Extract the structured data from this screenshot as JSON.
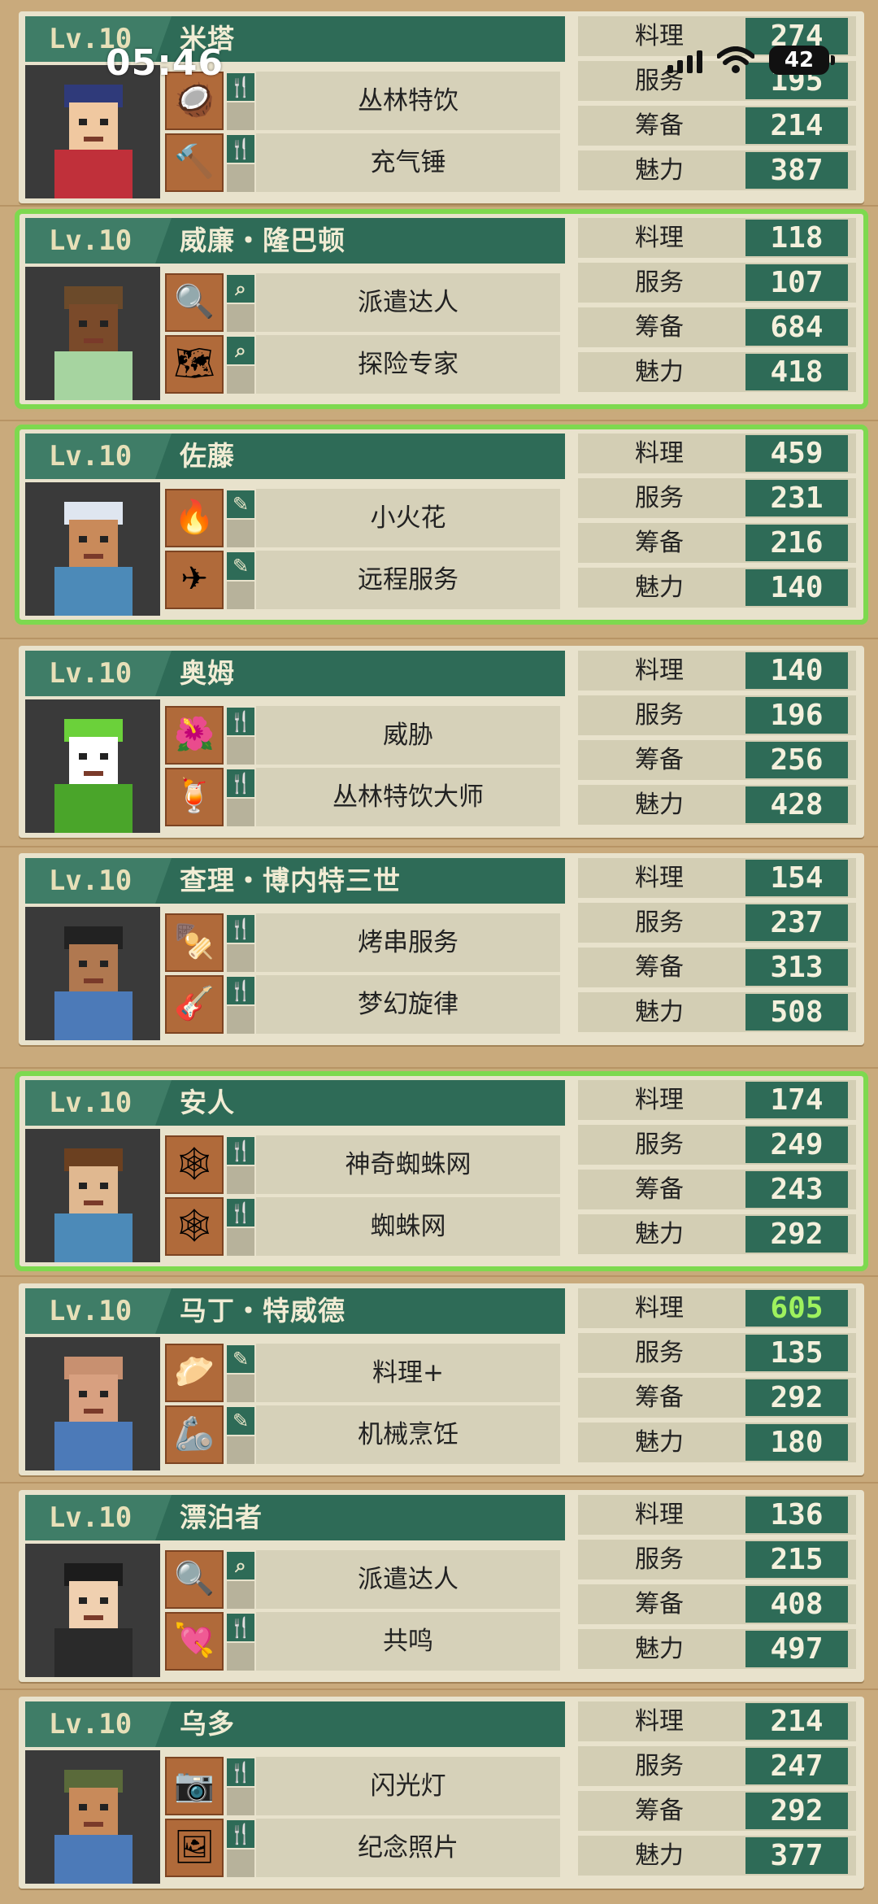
{
  "status_bar": {
    "time": "05:46",
    "battery": "42"
  },
  "stat_labels": [
    "料理",
    "服务",
    "筹备",
    "魅力"
  ],
  "characters": [
    {
      "level": "Lv.10",
      "name": "米塔",
      "selected": false,
      "skills": [
        {
          "label": "丛林特饮",
          "type": "fork-knife-icon",
          "icon": "coconut-drink-icon"
        },
        {
          "label": "充气锤",
          "type": "fork-knife-icon",
          "icon": "inflatable-hammer-icon"
        }
      ],
      "stats": [
        "274",
        "195",
        "214",
        "387"
      ]
    },
    {
      "level": "Lv.10",
      "name": "威廉・隆巴顿",
      "selected": true,
      "skills": [
        {
          "label": "派遣达人",
          "type": "magnifier-icon",
          "icon": "magnifier-icon"
        },
        {
          "label": "探险专家",
          "type": "magnifier-icon",
          "icon": "map-icon"
        }
      ],
      "stats": [
        "118",
        "107",
        "684",
        "418"
      ]
    },
    {
      "level": "Lv.10",
      "name": "佐藤",
      "selected": true,
      "skills": [
        {
          "label": "小火花",
          "type": "brush-icon",
          "icon": "flame-icon"
        },
        {
          "label": "远程服务",
          "type": "brush-icon",
          "icon": "paper-plane-icon"
        }
      ],
      "stats": [
        "459",
        "231",
        "216",
        "140"
      ]
    },
    {
      "level": "Lv.10",
      "name": "奥姆",
      "selected": false,
      "skills": [
        {
          "label": "威胁",
          "type": "fork-knife-icon",
          "icon": "monster-plant-icon"
        },
        {
          "label": "丛林特饮大师",
          "type": "fork-knife-icon",
          "icon": "coconut-drinks-icon"
        }
      ],
      "stats": [
        "140",
        "196",
        "256",
        "428"
      ]
    },
    {
      "level": "Lv.10",
      "name": "查理・博内特三世",
      "selected": false,
      "skills": [
        {
          "label": "烤串服务",
          "type": "fork-knife-icon",
          "icon": "skewer-icon"
        },
        {
          "label": "梦幻旋律",
          "type": "fork-knife-icon",
          "icon": "guitar-icon"
        }
      ],
      "stats": [
        "154",
        "237",
        "313",
        "508"
      ]
    },
    {
      "level": "Lv.10",
      "name": "安人",
      "selected": true,
      "skills": [
        {
          "label": "神奇蜘蛛网",
          "type": "fork-knife-icon",
          "icon": "magic-spider-web-icon"
        },
        {
          "label": "蜘蛛网",
          "type": "fork-knife-icon",
          "icon": "spider-web-icon"
        }
      ],
      "stats": [
        "174",
        "249",
        "243",
        "292"
      ]
    },
    {
      "level": "Lv.10",
      "name": "马丁・特威德",
      "selected": false,
      "skills": [
        {
          "label": "料理+",
          "type": "brush-icon",
          "icon": "dumpling-icon"
        },
        {
          "label": "机械烹饪",
          "type": "brush-icon",
          "icon": "robot-arm-icon"
        }
      ],
      "stats": [
        "605",
        "135",
        "292",
        "180"
      ],
      "highlight_stat": 0
    },
    {
      "level": "Lv.10",
      "name": "漂泊者",
      "selected": false,
      "skills": [
        {
          "label": "派遣达人",
          "type": "magnifier-icon",
          "icon": "magnifier-icon"
        },
        {
          "label": "共鸣",
          "type": "fork-knife-icon",
          "icon": "heart-arrow-icon"
        }
      ],
      "stats": [
        "136",
        "215",
        "408",
        "497"
      ]
    },
    {
      "level": "Lv.10",
      "name": "乌多",
      "selected": false,
      "skills": [
        {
          "label": "闪光灯",
          "type": "fork-knife-icon",
          "icon": "camera-icon"
        },
        {
          "label": "纪念照片",
          "type": "fork-knife-icon",
          "icon": "photo-icon"
        }
      ],
      "stats": [
        "214",
        "247",
        "292",
        "377"
      ]
    }
  ]
}
